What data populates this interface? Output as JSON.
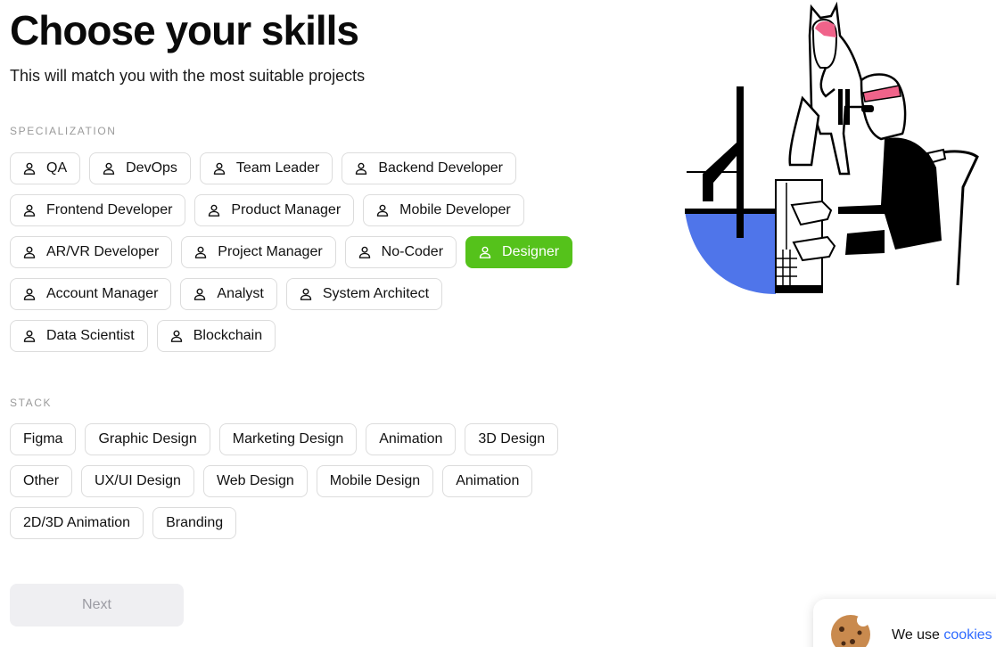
{
  "header": {
    "title": "Choose your skills",
    "subtitle": "This will match you with the most suitable projects"
  },
  "specialization": {
    "label": "SPECIALIZATION",
    "icon": "person-icon",
    "selected_color": "#55c21b",
    "items": [
      {
        "label": "QA",
        "selected": false
      },
      {
        "label": "DevOps",
        "selected": false
      },
      {
        "label": "Team Leader",
        "selected": false
      },
      {
        "label": "Backend Developer",
        "selected": false
      },
      {
        "label": "Frontend Developer",
        "selected": false
      },
      {
        "label": "Product Manager",
        "selected": false
      },
      {
        "label": "Mobile Developer",
        "selected": false
      },
      {
        "label": "AR/VR Developer",
        "selected": false
      },
      {
        "label": "Project Manager",
        "selected": false
      },
      {
        "label": "No-Coder",
        "selected": false
      },
      {
        "label": "Designer",
        "selected": true
      },
      {
        "label": "Account Manager",
        "selected": false
      },
      {
        "label": "Analyst",
        "selected": false
      },
      {
        "label": "System Architect",
        "selected": false
      },
      {
        "label": "Data Scientist",
        "selected": false
      },
      {
        "label": "Blockchain",
        "selected": false
      }
    ]
  },
  "stack": {
    "label": "STACK",
    "items": [
      {
        "label": "Figma"
      },
      {
        "label": "Graphic Design"
      },
      {
        "label": "Marketing Design"
      },
      {
        "label": "Animation"
      },
      {
        "label": "3D Design"
      },
      {
        "label": "Other"
      },
      {
        "label": "UX/UI Design"
      },
      {
        "label": "Web Design"
      },
      {
        "label": "Mobile Design"
      },
      {
        "label": "Animation"
      },
      {
        "label": "2D/3D Animation"
      },
      {
        "label": "Branding"
      }
    ]
  },
  "actions": {
    "next_label": "Next",
    "next_disabled": true
  },
  "cookie_banner": {
    "icon": "cookie-icon",
    "text_prefix": "We use ",
    "link_text": "cookies",
    "link_color": "#2f6bff"
  },
  "illustration": {
    "icon": "developers-illustration",
    "accent_blue": "#4f75ea",
    "accent_pink": "#f0638a"
  }
}
